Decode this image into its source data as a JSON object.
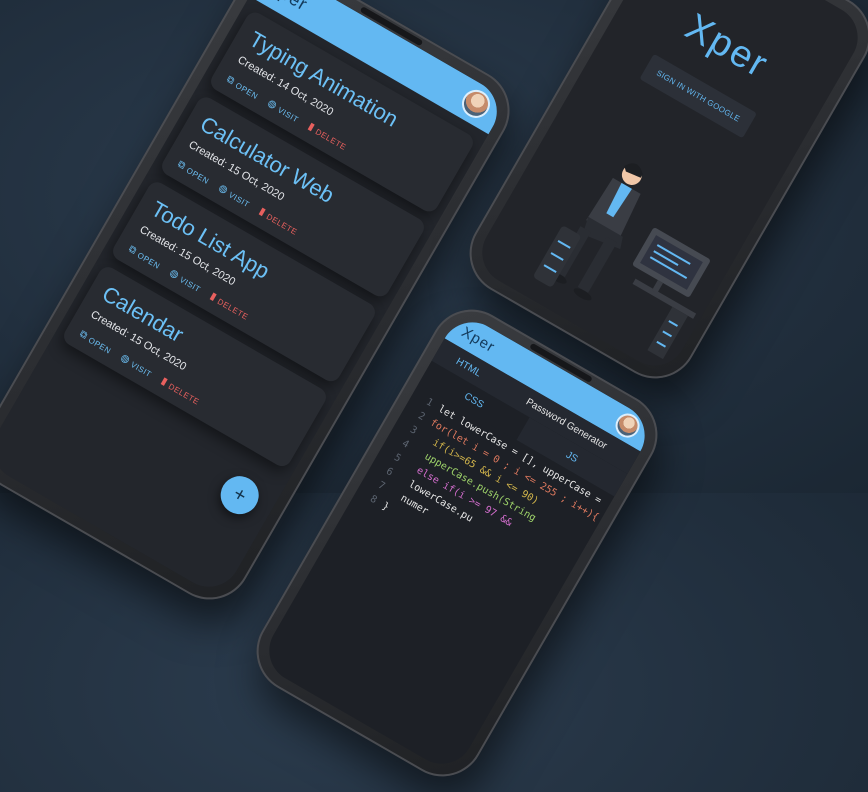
{
  "list_app": {
    "logo": "Xper",
    "projects": [
      {
        "title": "Typing Animation",
        "created": "Created: 14 Oct, 2020"
      },
      {
        "title": "Calculator Web",
        "created": "Created: 15 Oct, 2020"
      },
      {
        "title": "Todo List App",
        "created": "Created: 15 Oct, 2020"
      },
      {
        "title": "Calendar",
        "created": "Created: 15 Oct, 2020"
      }
    ],
    "actions": {
      "open": "OPEN",
      "visit": "VISIT",
      "delete": "DELETE"
    },
    "fab_label": "+"
  },
  "login_app": {
    "logo": "Xper",
    "google_button": "SIGN IN WITH GOOGLE"
  },
  "editor_app": {
    "logo": "Xper",
    "title": "Password Generator",
    "tabs": {
      "html": "HTML",
      "css": "CSS",
      "js": "JS"
    },
    "line_numbers": [
      "1",
      "2",
      "3",
      "4",
      "5",
      "6",
      "7",
      "8"
    ],
    "code_lines": [
      "let lowerCase = [], upperCase =",
      "for(let i = 0 ; i <= 255 ; i++){",
      "  if(i>=65 && i <= 90)",
      "  upperCase.push(String",
      "  else if(i >= 97 &&",
      "  lowerCase.pu",
      "  numer",
      "}"
    ]
  },
  "colors": {
    "accent": "#63b8f2",
    "danger": "#e8605e",
    "background": "#22303f"
  }
}
